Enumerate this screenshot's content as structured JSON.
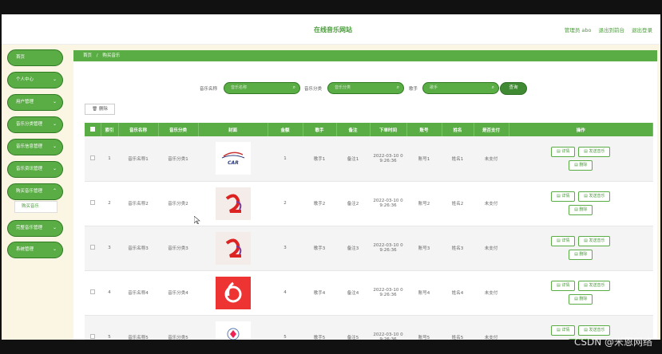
{
  "header": {
    "site_title": "在线音乐网站",
    "admin_label": "管理员 abo",
    "exit_backend": "退出到前台",
    "logout": "退出登录"
  },
  "sidebar": {
    "items": [
      {
        "label": "首页",
        "chevron": ""
      },
      {
        "label": "个人中心",
        "chevron": "⌄"
      },
      {
        "label": "用户管理",
        "chevron": "⌄"
      },
      {
        "label": "音乐分类管理",
        "chevron": "⌄"
      },
      {
        "label": "音乐信息管理",
        "chevron": "⌄"
      },
      {
        "label": "音乐资讯管理",
        "chevron": "⌄"
      },
      {
        "label": "购买音乐管理",
        "chevron": "⌃"
      },
      {
        "label": "完整音乐管理",
        "chevron": "⌄"
      },
      {
        "label": "系统管理",
        "chevron": "⌄"
      }
    ],
    "submenu_label": "购买音乐"
  },
  "breadcrumb": {
    "home": "首页",
    "sep": "/",
    "current": "购买音乐"
  },
  "search": {
    "name_label": "音乐名称",
    "name_placeholder": "音乐名称",
    "category_label": "音乐分类",
    "category_placeholder": "音乐分类",
    "singer_label": "歌手",
    "singer_placeholder": "歌手",
    "query_button": "查询"
  },
  "toolbar": {
    "delete_label": "删除"
  },
  "table": {
    "headers": [
      "",
      "索引",
      "音乐名称",
      "音乐分类",
      "封面",
      "金额",
      "歌手",
      "备注",
      "下单时间",
      "账号",
      "姓名",
      "是否支付",
      "操作"
    ],
    "rows": [
      {
        "index": "1",
        "name": "音乐名称1",
        "category": "音乐分类1",
        "amount": "1",
        "singer": "歌手1",
        "note": "备注1",
        "time1": "2022-03-10 0",
        "time2": "9:26:36",
        "account": "账号1",
        "fullname": "姓名1",
        "paid": "未支付",
        "cover_text": "CAR"
      },
      {
        "index": "2",
        "name": "音乐名称2",
        "category": "音乐分类2",
        "amount": "2",
        "singer": "歌手2",
        "note": "备注2",
        "time1": "2022-03-10 0",
        "time2": "9:26:36",
        "account": "账号2",
        "fullname": "姓名2",
        "paid": "未支付",
        "cover_text": ""
      },
      {
        "index": "3",
        "name": "音乐名称3",
        "category": "音乐分类3",
        "amount": "3",
        "singer": "歌手3",
        "note": "备注3",
        "time1": "2022-03-10 0",
        "time2": "9:26:36",
        "account": "账号3",
        "fullname": "姓名3",
        "paid": "未支付",
        "cover_text": ""
      },
      {
        "index": "4",
        "name": "音乐名称4",
        "category": "音乐分类4",
        "amount": "4",
        "singer": "歌手4",
        "note": "备注4",
        "time1": "2022-03-10 0",
        "time2": "9:26:36",
        "account": "账号4",
        "fullname": "姓名4",
        "paid": "未支付",
        "cover_text": ""
      },
      {
        "index": "5",
        "name": "音乐名称5",
        "category": "音乐分类5",
        "amount": "5",
        "singer": "歌手5",
        "note": "备注5",
        "time1": "2022-03-10 0",
        "time2": "9:26:36",
        "account": "账号5",
        "fullname": "姓名5",
        "paid": "未支付",
        "cover_text": ""
      }
    ],
    "action_detail": "详情",
    "action_send": "发送音乐",
    "action_delete": "删除"
  },
  "watermark": "CSDN @米恩网络",
  "colors": {
    "accent": "#5aac45",
    "accent_dark": "#2f7a23",
    "page_bg": "#fbf5e3"
  }
}
